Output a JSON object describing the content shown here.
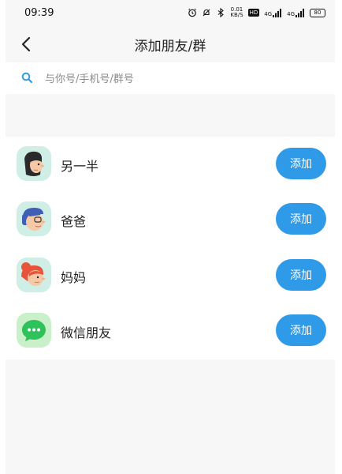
{
  "status_bar": {
    "time": "09:39",
    "net_speed_value": "0.01",
    "net_speed_unit": "KB/S",
    "hd_badge": "HD",
    "signal_1": "4G",
    "signal_2": "4G",
    "battery": "80"
  },
  "nav": {
    "title": "添加朋友/群"
  },
  "search": {
    "placeholder": "与你号/手机号/群号"
  },
  "contacts": [
    {
      "name": "另一半",
      "button": "添加",
      "avatar": "woman-dark-hair-icon"
    },
    {
      "name": "爸爸",
      "button": "添加",
      "avatar": "man-glasses-icon"
    },
    {
      "name": "妈妈",
      "button": "添加",
      "avatar": "woman-red-hair-icon"
    },
    {
      "name": "微信朋友",
      "button": "添加",
      "avatar": "wechat-chat-icon"
    }
  ],
  "colors": {
    "accent": "#2f9be8",
    "background": "#f7f7f7",
    "wechat_green": "#2fc15a"
  }
}
